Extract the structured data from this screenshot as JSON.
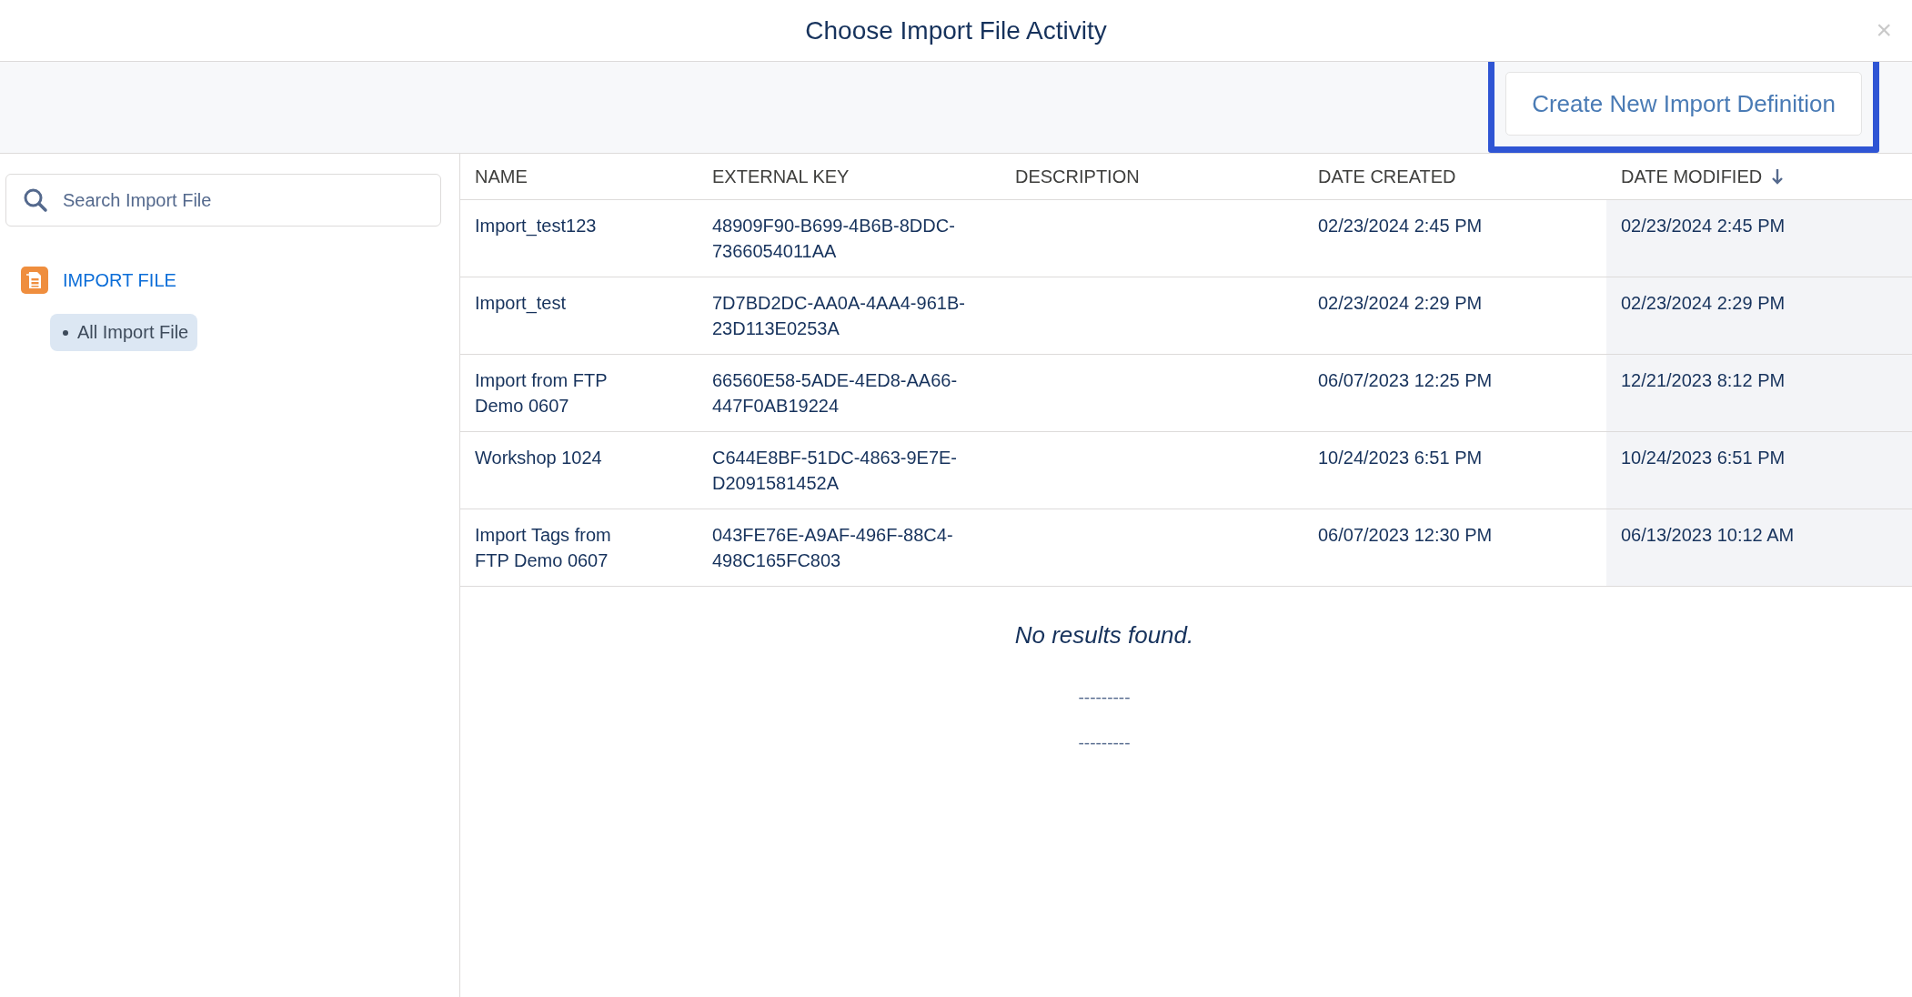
{
  "window": {
    "title": "Choose Import File Activity",
    "close": "×"
  },
  "toolbar": {
    "button": {
      "label": "Create New Import Definition",
      "highlighted": true
    }
  },
  "sidebar": {
    "search": {
      "placeholder": "Search Import File"
    },
    "folder": {
      "label": "IMPORT FILE",
      "items": [
        {
          "label": "All Import File",
          "selected": true
        }
      ]
    }
  },
  "table": {
    "columns": [
      {
        "label": "NAME",
        "sorted": false
      },
      {
        "label": "EXTERNAL KEY",
        "sorted": false
      },
      {
        "label": "DESCRIPTION",
        "sorted": false
      },
      {
        "label": "DATE CREATED",
        "sorted": false
      },
      {
        "label": "DATE MODIFIED",
        "sorted": true
      }
    ],
    "rows": [
      [
        "Import_test123",
        "48909F90-B699-4B6B-8DDC-7366054011AA",
        "",
        "02/23/2024 2:45 PM",
        "02/23/2024 2:45 PM"
      ],
      [
        "Import_test",
        "7D7BD2DC-AA0A-4AA4-961B-23D113E0253A",
        "",
        "02/23/2024 2:29 PM",
        "02/23/2024 2:29 PM"
      ],
      [
        "Import from FTP Demo 0607",
        "66560E58-5ADE-4ED8-AA66-447F0AB19224",
        "",
        "06/07/2023 12:25 PM",
        "12/21/2023 8:12 PM"
      ],
      [
        "Workshop 1024",
        "C644E8BF-51DC-4863-9E7E-D2091581452A",
        "",
        "10/24/2023 6:51 PM",
        "10/24/2023 6:51 PM"
      ],
      [
        "Import Tags from FTP Demo 0607",
        "043FE76E-A9AF-496F-88C4-498C165FC803",
        "",
        "06/07/2023 12:30 PM",
        "06/13/2023 10:12 AM"
      ]
    ],
    "empty_message": "No results found.",
    "footer_lines": [
      "---------",
      "---------"
    ]
  }
}
